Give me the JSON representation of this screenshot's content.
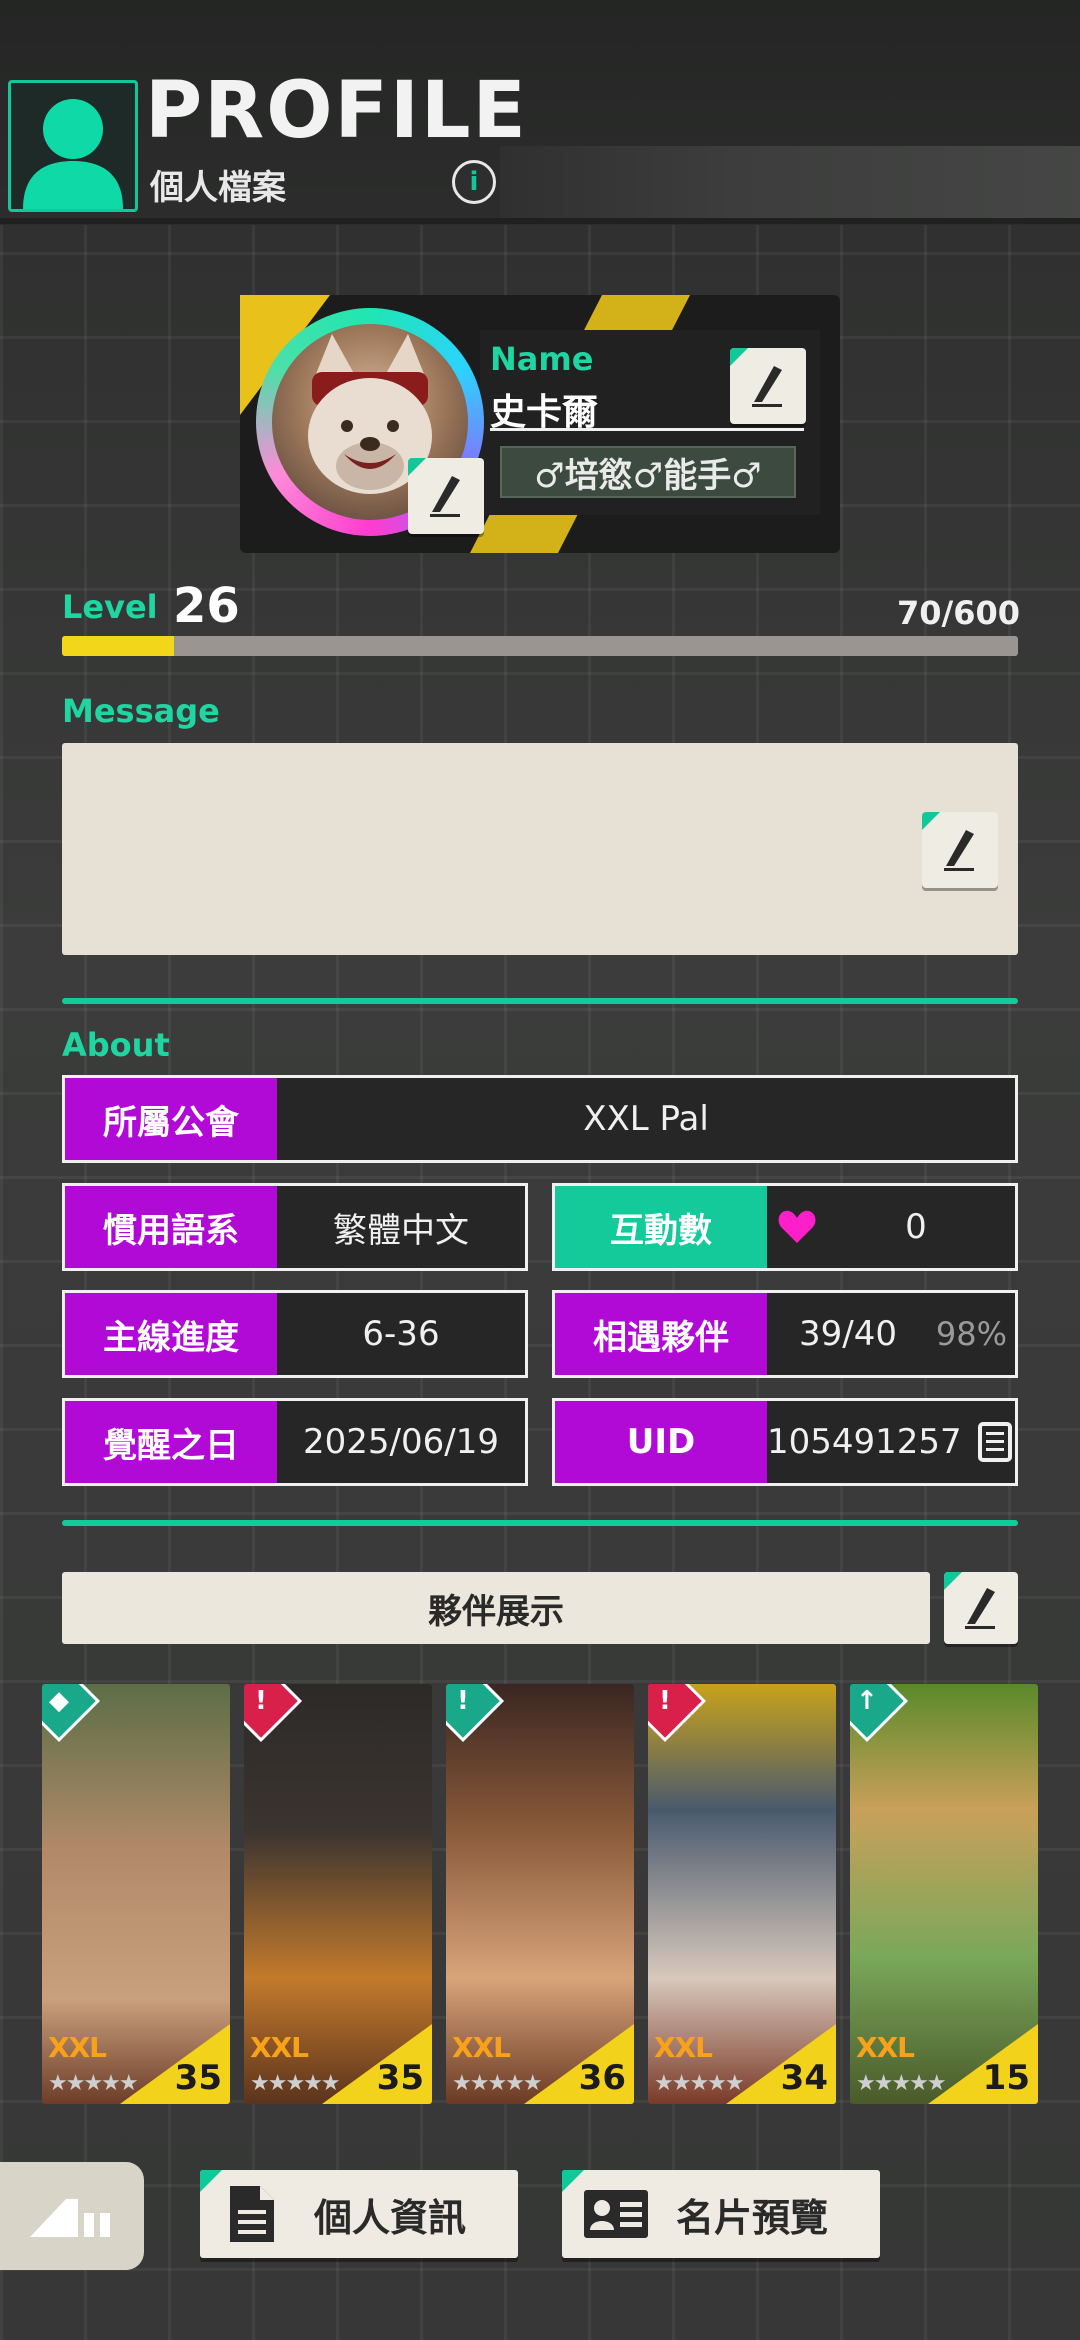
{
  "header": {
    "title_en": "PROFILE",
    "title_zh": "個人檔案",
    "info_glyph": "i"
  },
  "profile": {
    "name_label": "Name",
    "name": "史卡爾",
    "title_tag": "♂培慾♂能手♂"
  },
  "level": {
    "label": "Level",
    "value": "26",
    "exp_text": "70/600",
    "exp_fraction": 0.1167
  },
  "message": {
    "label": "Message",
    "text": ""
  },
  "about": {
    "label": "About",
    "guild_key": "所屬公會",
    "guild_value": "XXL Pal",
    "language_key": "慣用語系",
    "language_value": "繁體中文",
    "interactions_key": "互動數",
    "interactions_value": "0",
    "progress_key": "主線進度",
    "progress_value": "6-36",
    "pals_met_key": "相遇夥伴",
    "pals_met_value": "39/40",
    "pals_met_percent": "98%",
    "awaken_key": "覺醒之日",
    "awaken_value": "2025/06/19",
    "uid_key": "UID",
    "uid_value": "105491257"
  },
  "showcase": {
    "label": "夥伴展示",
    "pals": [
      {
        "level": "35",
        "badge": "teal",
        "xxl": "XXL",
        "stars": "★★★★★"
      },
      {
        "level": "35",
        "badge": "red",
        "xxl": "XXL",
        "stars": "★★★★★"
      },
      {
        "level": "36",
        "badge": "teal",
        "xxl": "XXL",
        "stars": "★★★★★"
      },
      {
        "level": "34",
        "badge": "red",
        "xxl": "XXL",
        "stars": "★★★★★"
      },
      {
        "level": "15",
        "badge": "teal",
        "xxl": "XXL",
        "stars": "★★★★★"
      }
    ]
  },
  "bottom": {
    "personal_info": "個人資訊",
    "card_preview": "名片預覽"
  },
  "colors": {
    "accent_green": "#14c99a",
    "key_purple": "#b10ad6",
    "exp_yellow": "#f1d61a",
    "heart": "#ff1fc8"
  },
  "icons": [
    "user-icon",
    "info-icon",
    "edit-icon",
    "heart-icon",
    "copy-icon",
    "document-icon",
    "id-card-icon",
    "signal-icon"
  ]
}
